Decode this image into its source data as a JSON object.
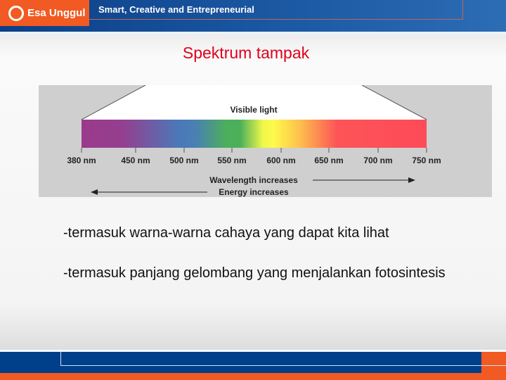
{
  "header": {
    "logo_text": "Esa Unggul",
    "tagline": "Smart, Creative and Entrepreneurial",
    "brand_colors": {
      "blue": "#0b3f86",
      "orange": "#f15a22"
    }
  },
  "slide": {
    "title": "Spektrum tampak",
    "bullets": [
      "-termasuk warna-warna cahaya yang dapat kita lihat",
      "-termasuk panjang gelombang yang menjalankan fotosintesis"
    ]
  },
  "diagram": {
    "label": "Visible light",
    "ticks": [
      "380 nm",
      "450 nm",
      "500 nm",
      "550 nm",
      "600 nm",
      "650 nm",
      "700 nm",
      "750 nm"
    ],
    "tick_values": [
      380,
      450,
      500,
      550,
      600,
      650,
      700,
      750
    ],
    "wavelength_label": "Wavelength increases",
    "energy_label": "Energy increases"
  }
}
